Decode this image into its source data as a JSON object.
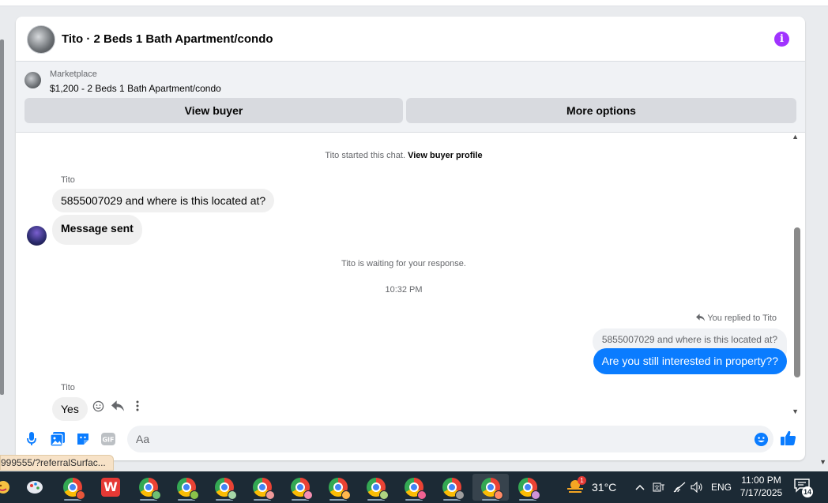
{
  "chat": {
    "header": {
      "title": "Tito · 2 Beds 1 Bath Apartment/condo",
      "info_icon": "info-icon"
    },
    "marketplace": {
      "category": "Marketplace",
      "listing": "$1,200 - 2 Beds 1 Bath Apartment/condo",
      "buttons": {
        "view_buyer": "View buyer",
        "more_options": "More options"
      }
    },
    "messages": {
      "started_prefix": "Tito started this chat.",
      "view_buyer_profile": "View buyer profile",
      "sender1": "Tito",
      "msg1": "5855007029 and where is this located at?",
      "msg2": "Message sent",
      "waiting": "Tito is waiting for your response.",
      "time": "10:32 PM",
      "replied_to": "You replied to Tito",
      "quoted": "5855007029 and where is this located at?",
      "reply": "Are you still interested in property??",
      "sender2": "Tito",
      "msg3": "Yes"
    },
    "composer": {
      "placeholder": "Aa"
    }
  },
  "url_tooltip": "999555/?referralSurfac...",
  "taskbar": {
    "weather": {
      "temp": "31°C",
      "badge": "1"
    },
    "language": "ENG",
    "time": "11:00 PM",
    "date": "7/17/2025",
    "notifications": "14",
    "apps": [
      "chrome-icon",
      "wps-office-icon",
      "chrome-icon",
      "chrome-icon",
      "chrome-icon",
      "chrome-icon",
      "chrome-icon",
      "chrome-icon",
      "chrome-icon",
      "chrome-icon",
      "chrome-icon",
      "chrome-icon",
      "chrome-icon"
    ]
  },
  "colors": {
    "accent": "#0a7cff",
    "info": "#a033ff",
    "bubble": "#f0f0f0",
    "taskbar": "#1c2a35"
  }
}
